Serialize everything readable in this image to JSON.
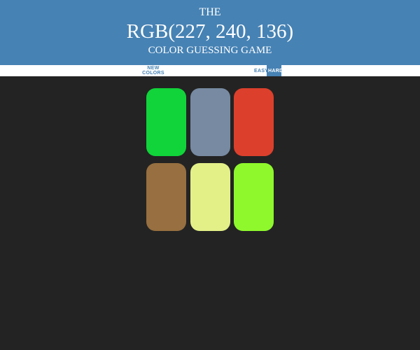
{
  "header": {
    "line1": "THE",
    "rgb_display": "RGB(227, 240, 136)",
    "line3": "COLOR GUESSING GAME"
  },
  "stripe": {
    "new_colors_label": "NEW COLORS",
    "easy_label": "EASY",
    "hard_label": "HARD",
    "active_mode": "hard"
  },
  "squares": [
    {
      "color": "#10d43a"
    },
    {
      "color": "#778aa2"
    },
    {
      "color": "#dc402c"
    },
    {
      "color": "#976f40"
    },
    {
      "color": "#e3f088"
    },
    {
      "color": "#8ef82c"
    }
  ]
}
